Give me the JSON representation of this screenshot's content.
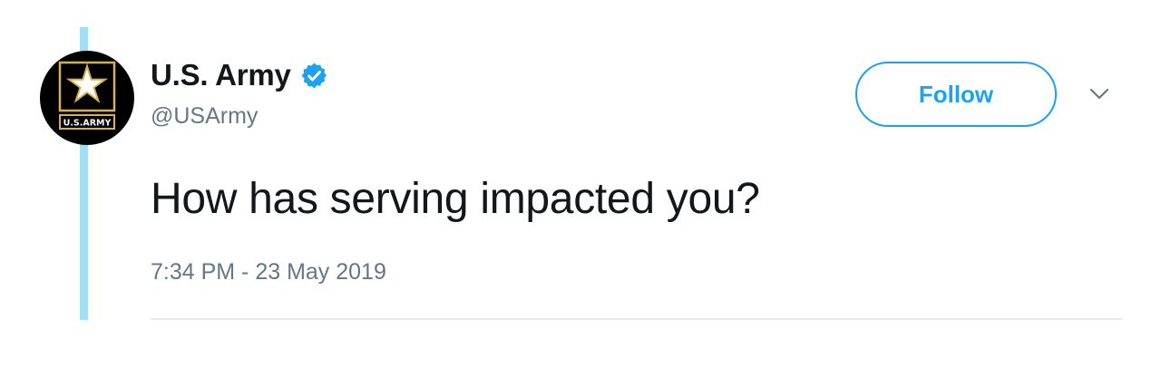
{
  "author": {
    "display_name": "U.S. Army",
    "handle": "@USArmy",
    "verified": true,
    "avatar_logo_text": "U.S.ARMY",
    "avatar_icon": "army-star-logo-icon",
    "verified_icon": "verified-badge-icon"
  },
  "actions": {
    "follow_label": "Follow",
    "menu_icon": "chevron-down-icon"
  },
  "tweet": {
    "text": "How has serving impacted you?",
    "timestamp": "7:34 PM - 23 May 2019"
  },
  "colors": {
    "accent": "#1da1f2",
    "thread_line": "#a3def7",
    "text_primary": "#14171a",
    "text_secondary": "#657786",
    "avatar_background": "#000000",
    "logo_gold": "#d4b24c"
  }
}
